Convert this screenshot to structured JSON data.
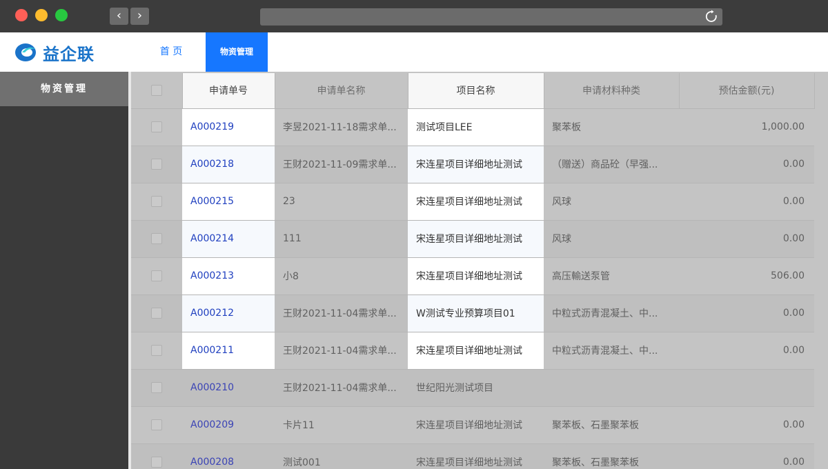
{
  "app": {
    "logo_text": "益企联"
  },
  "topnav": {
    "home": "首 页",
    "active": "物资管理"
  },
  "sidebar": {
    "items": [
      {
        "label": "物资管理"
      }
    ]
  },
  "table": {
    "headers": [
      "申请单号",
      "申请单名称",
      "项目名称",
      "申请材料种类",
      "预估金额(元)"
    ],
    "rows": [
      [
        "A000219",
        "李昱2021-11-18需求单...",
        "测试项目LEE",
        "聚苯板",
        "1,000.00"
      ],
      [
        "A000218",
        "王财2021-11-09需求单...",
        "宋连星项目详细地址测试",
        "（赠送）商品砼（早强...",
        "0.00"
      ],
      [
        "A000215",
        "23",
        "宋连星项目详细地址测试",
        "风球",
        "0.00"
      ],
      [
        "A000214",
        "111",
        "宋连星项目详细地址测试",
        "风球",
        "0.00"
      ],
      [
        "A000213",
        "小8",
        "宋连星项目详细地址测试",
        "高压輸送泵管",
        "506.00"
      ],
      [
        "A000212",
        "王财2021-11-04需求单...",
        "W测试专业预算项目01",
        "中粒式沥青混凝土、中...",
        "0.00"
      ],
      [
        "A000211",
        "王财2021-11-04需求单...",
        "宋连星项目详细地址测试",
        "中粒式沥青混凝土、中...",
        "0.00"
      ],
      [
        "A000210",
        "王财2021-11-04需求单...",
        "世纪阳光测试项目",
        "",
        ""
      ],
      [
        "A000209",
        "卡片11",
        "宋连星项目详细地址测试",
        "聚苯板、石墨聚苯板",
        "0.00"
      ],
      [
        "A000208",
        "测试001",
        "宋连星项目详细地址测试",
        "聚苯板、石墨聚苯板",
        "0.00"
      ]
    ]
  }
}
